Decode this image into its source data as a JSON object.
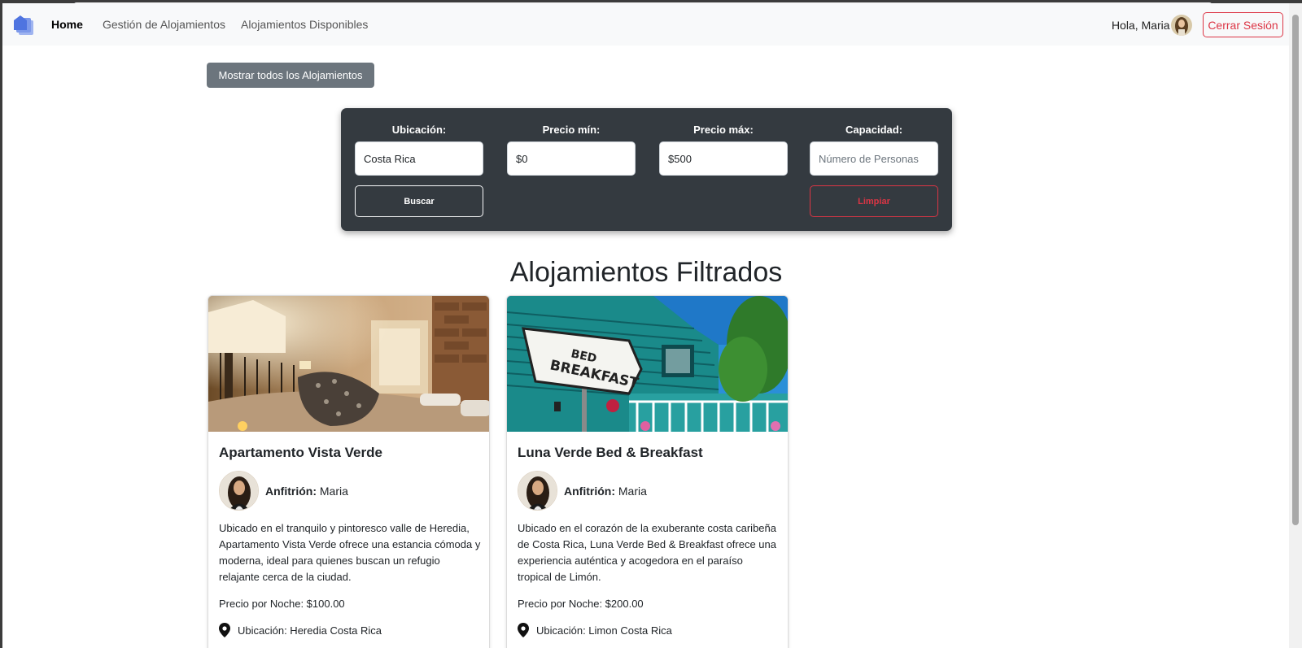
{
  "navbar": {
    "links": [
      {
        "label": "Home",
        "active": true
      },
      {
        "label": "Gestión de Alojamientos",
        "active": false
      },
      {
        "label": "Alojamientos Disponibles",
        "active": false
      }
    ],
    "greeting": "Hola, Maria",
    "logout_label": "Cerrar Sesión"
  },
  "show_all_label": "Mostrar todos los Alojamientos",
  "filters": {
    "location_label": "Ubicación:",
    "location_value": "Costa Rica",
    "min_price_label": "Precio mín:",
    "min_price_value": "$0",
    "max_price_label": "Precio máx:",
    "max_price_value": "$500",
    "capacity_label": "Capacidad:",
    "capacity_placeholder": "Número de Personas",
    "search_label": "Buscar",
    "clear_label": "Limpiar"
  },
  "section_title": "Alojamientos Filtrados",
  "listings": [
    {
      "title": "Apartamento Vista Verde",
      "host_label": "Anfitrión:",
      "host_name": "Maria",
      "description": "Ubicado en el tranquilo y pintoresco valle de Heredia, Apartamento Vista Verde ofrece una estancia cómoda y moderna, ideal para quienes buscan un refugio relajante cerca de la ciudad.",
      "price": "Precio por Noche: $100.00",
      "location": "Ubicación: Heredia Costa Rica"
    },
    {
      "title": "Luna Verde Bed & Breakfast",
      "host_label": "Anfitrión:",
      "host_name": "Maria",
      "description": "Ubicado en el corazón de la exuberante costa caribeña de Costa Rica, Luna Verde Bed & Breakfast ofrece una experiencia auténtica y acogedora en el paraíso tropical de Limón.",
      "price": "Precio por Noche: $200.00",
      "location": "Ubicación: Limon Costa Rica",
      "image_sign": [
        "BED",
        "BREAKFAST"
      ]
    }
  ],
  "colors": {
    "danger": "#dc3545",
    "panel": "#343a40",
    "secondary": "#6c757d"
  }
}
